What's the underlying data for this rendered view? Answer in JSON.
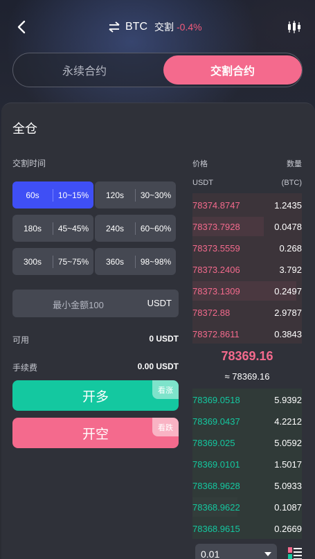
{
  "header": {
    "symbol": "BTC",
    "contract_type": "交割",
    "change": "-0.4%"
  },
  "switch": {
    "perpetual_label": "永续合约",
    "delivery_label": "交割合约",
    "active": "交割合约"
  },
  "form": {
    "margin_mode": "全仓",
    "time_label": "交割时间",
    "time_options": [
      {
        "time": "60s",
        "range": "10~15%",
        "active": true
      },
      {
        "time": "120s",
        "range": "30~30%",
        "active": false
      },
      {
        "time": "180s",
        "range": "45~45%",
        "active": false
      },
      {
        "time": "240s",
        "range": "60~60%",
        "active": false
      },
      {
        "time": "300s",
        "range": "75~75%",
        "active": false
      },
      {
        "time": "360s",
        "range": "98~98%",
        "active": false
      }
    ],
    "amount_placeholder": "最小金额100",
    "amount_unit": "USDT",
    "available_label": "可用",
    "available_value": "0 USDT",
    "fee_label": "手续费",
    "fee_value": "0.00 USDT",
    "long_label": "开多",
    "long_tag": "看涨",
    "short_label": "开空",
    "short_tag": "看跌"
  },
  "orderbook": {
    "price_label": "价格",
    "qty_label": "数量",
    "price_unit": "USDT",
    "qty_unit": "(BTC)",
    "asks": [
      {
        "price": "78374.8747",
        "qty": "1.2435",
        "depth": 0.0
      },
      {
        "price": "78373.7928",
        "qty": "0.0478",
        "depth": 0.65
      },
      {
        "price": "78373.5559",
        "qty": "0.268",
        "depth": 0.0
      },
      {
        "price": "78373.2406",
        "qty": "3.792",
        "depth": 0.0
      },
      {
        "price": "78373.1309",
        "qty": "0.2497",
        "depth": 0.95
      },
      {
        "price": "78372.88",
        "qty": "2.9787",
        "depth": 0.0
      },
      {
        "price": "78372.8611",
        "qty": "0.3843",
        "depth": 0.0
      }
    ],
    "last_price": "78369.16",
    "mark_price": "≈ 78369.16",
    "bids": [
      {
        "price": "78369.0518",
        "qty": "5.9392",
        "depth": 0.0
      },
      {
        "price": "78369.0437",
        "qty": "4.2212",
        "depth": 0.0
      },
      {
        "price": "78369.025",
        "qty": "5.0592",
        "depth": 0.0
      },
      {
        "price": "78369.0101",
        "qty": "1.5017",
        "depth": 0.0
      },
      {
        "price": "78368.9628",
        "qty": "5.0933",
        "depth": 0.0
      },
      {
        "price": "78368.9622",
        "qty": "0.1087",
        "depth": 0.41
      },
      {
        "price": "78368.9615",
        "qty": "0.2669",
        "depth": 0.0
      }
    ],
    "precision": "0.01"
  },
  "colors": {
    "accent_pink": "#f46a8d",
    "accent_green": "#14c8a0",
    "accent_blue": "#3f4ff5"
  },
  "icons": {
    "back": "back-arrow-icon",
    "swap": "swap-icon",
    "chart": "candlestick-chart-icon",
    "layout": "orderbook-layout-icon"
  }
}
